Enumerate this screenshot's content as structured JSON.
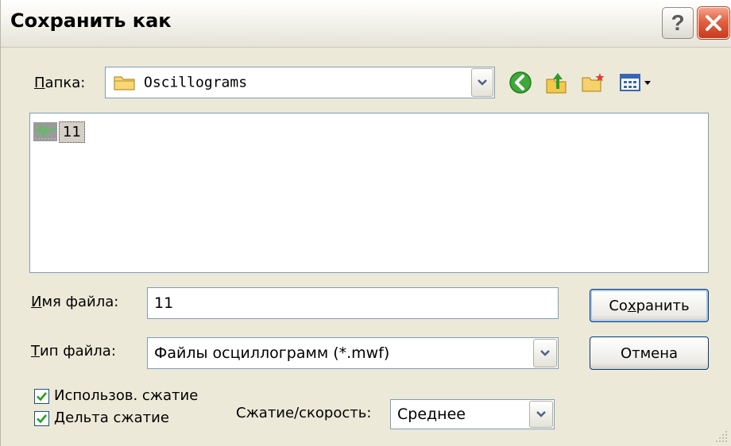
{
  "dialog": {
    "title": "Сохранить как"
  },
  "folder": {
    "label": "Папка:",
    "label_accel": "П",
    "label_rest": "апка:",
    "value": "Oscillograms"
  },
  "files": [
    {
      "name": "11"
    }
  ],
  "filename": {
    "label_accel": "И",
    "label_rest": "мя файла:",
    "value": "11"
  },
  "filetype": {
    "label_accel": "Т",
    "label_rest": "ип файла:",
    "value": "Файлы осциллограмм (*.mwf)"
  },
  "buttons": {
    "save_pre": "Со",
    "save_accel": "х",
    "save_post": "ранить",
    "cancel": "Отмена"
  },
  "options": {
    "use_compression": {
      "label": "Использов. сжатие",
      "checked": true
    },
    "delta_compression": {
      "label": "Дельта сжатие",
      "checked": true
    },
    "speed_label": "Сжатие/скорость:",
    "speed_value": "Среднее"
  },
  "icons": {
    "back": "back-icon",
    "up": "up-folder-icon",
    "new_folder": "new-folder-icon",
    "view_menu": "view-menu-icon"
  },
  "colors": {
    "accent_border": "#7f9db9",
    "button_border": "#003c74",
    "close_red": "#e26142"
  }
}
